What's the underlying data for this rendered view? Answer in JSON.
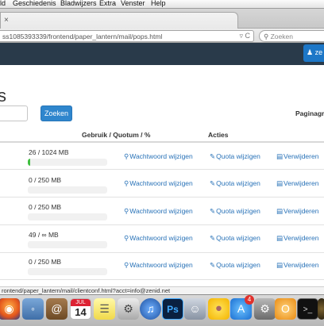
{
  "menubar": {
    "items": [
      "ld",
      "Geschiedenis",
      "Bladwijzers",
      "Extra",
      "Venster",
      "Help"
    ]
  },
  "browser": {
    "tab_close_glyph": "×",
    "url": "ss1085393339/frontend/paper_lantern/mail/pops.html",
    "search_placeholder": "Zoeken",
    "status_url": "rontend/paper_lantern/mail/clientconf.html?acct=info@zenid.net"
  },
  "header": {
    "user_label": "ze"
  },
  "page": {
    "title": "s",
    "search_button": "Zoeken",
    "page_size_label": "Paginagr"
  },
  "table": {
    "headers": {
      "usage": "Gebruik / Quotum / %",
      "actions": "Acties"
    },
    "rows": [
      {
        "usage": "26 / 1024 MB",
        "fill": 0.025,
        "pw": "Wachtwoord wijzigen",
        "quota": "Quota wijzigen",
        "del": "Verwijderen"
      },
      {
        "usage": "0 / 250 MB",
        "fill": 0,
        "pw": "Wachtwoord wijzigen",
        "quota": "Quota wijzigen",
        "del": "Verwijderen"
      },
      {
        "usage": "0 / 250 MB",
        "fill": 0,
        "pw": "Wachtwoord wijzigen",
        "quota": "Quota wijzigen",
        "del": "Verwijderen"
      },
      {
        "usage": "49 / ∞ MB",
        "fill": 0,
        "pw": "Wachtwoord wijzigen",
        "quota": "Quota wijzigen",
        "del": "Verwijderen"
      },
      {
        "usage": "0 / 250 MB",
        "fill": 0,
        "pw": "Wachtwoord wijzigen",
        "quota": "Quota wijzigen",
        "del": "Verwijderen"
      }
    ]
  },
  "icons": {
    "key": "key-icon",
    "pencil": "pencil-icon",
    "trash": "trash-icon",
    "user": "user-icon",
    "reload": "reload-icon"
  },
  "colors": {
    "header_bg": "#293a4a",
    "accent": "#2f86cd",
    "link": "#2a73b8",
    "bar_fill": "#3fbf3f"
  },
  "dock": {
    "calendar_day": "14",
    "calendar_month": "JUL",
    "ps_label": "Ps",
    "appstore_badge": "4"
  }
}
